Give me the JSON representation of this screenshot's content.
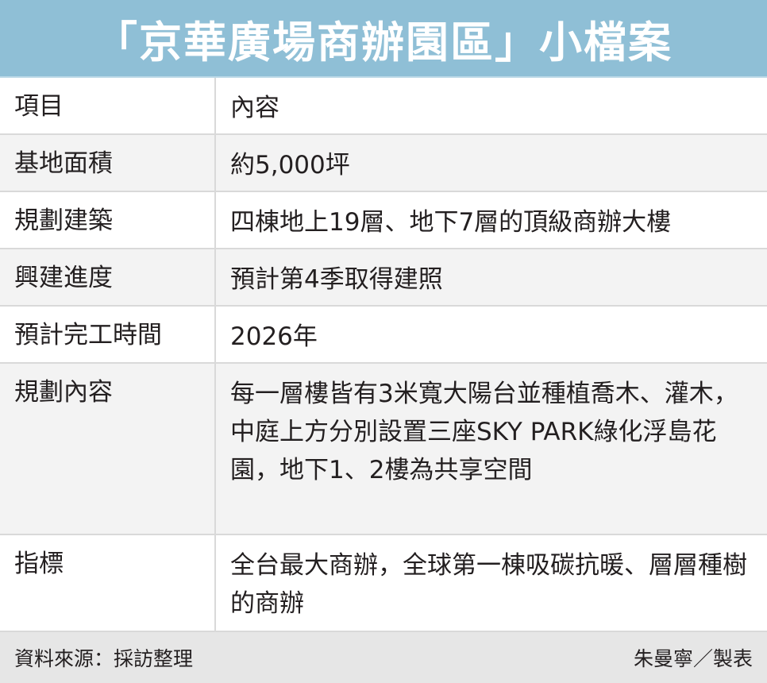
{
  "title": "「京華廣場商辦園區」小檔案",
  "table": {
    "header": {
      "key": "項目",
      "value": "內容"
    },
    "rows": [
      {
        "key": "基地面積",
        "value": "約5,000坪"
      },
      {
        "key": "規劃建築",
        "value": "四棟地上19層、地下7層的頂級商辦大樓"
      },
      {
        "key": "興建進度",
        "value": "預計第4季取得建照"
      },
      {
        "key": "預計完工時間",
        "value": "2026年"
      },
      {
        "key": "規劃內容",
        "value": "每一層樓皆有3米寬大陽台並種植喬木、灌木，中庭上方分別設置三座SKY PARK綠化浮島花園，地下1、2樓為共享空間"
      },
      {
        "key": "指標",
        "value": "全台最大商辦，全球第一棟吸碳抗暖、層層種樹的商辦"
      }
    ]
  },
  "footer": {
    "source": "資料來源：採訪整理",
    "credit": "朱曼寧／製表"
  }
}
